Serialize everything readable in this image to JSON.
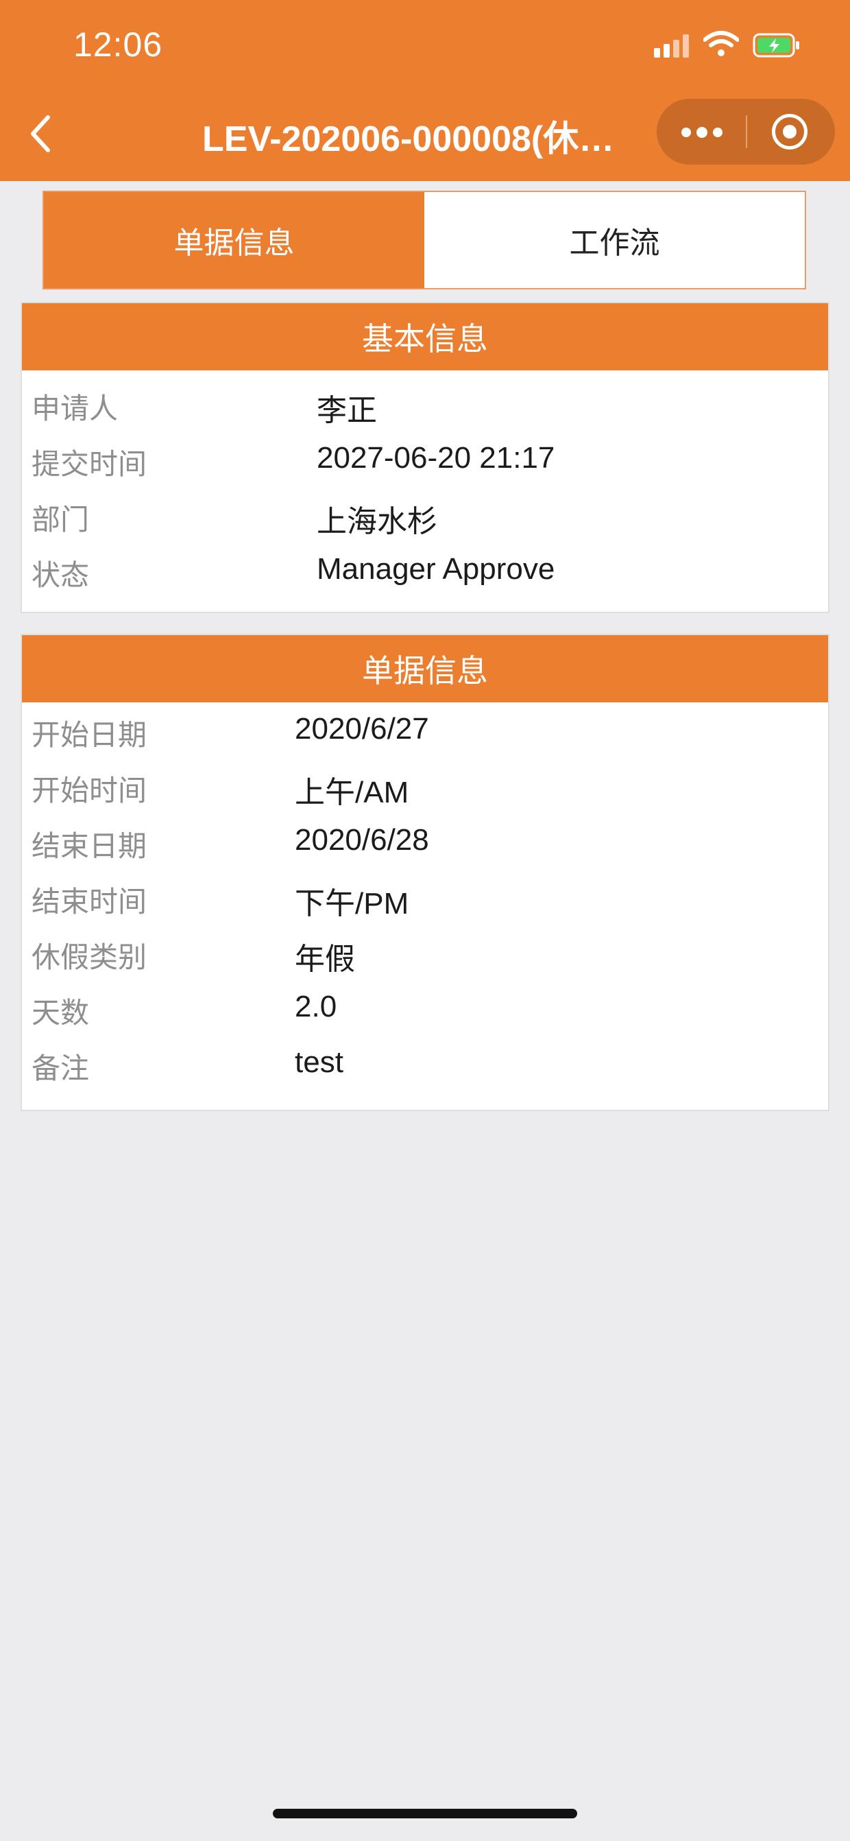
{
  "status_bar": {
    "time": "12:06"
  },
  "nav": {
    "title": "LEV-202006-000008(休…"
  },
  "tabs": [
    {
      "label": "单据信息",
      "active": true
    },
    {
      "label": "工作流",
      "active": false
    }
  ],
  "basic_info": {
    "title": "基本信息",
    "rows": [
      {
        "label": "申请人",
        "value": "李正"
      },
      {
        "label": "提交时间",
        "value": "2027-06-20 21:17"
      },
      {
        "label": "部门",
        "value": "上海水杉"
      },
      {
        "label": "状态",
        "value": "Manager Approve"
      }
    ]
  },
  "document_info": {
    "title": "单据信息",
    "rows": [
      {
        "label": "开始日期",
        "value": "2020/6/27"
      },
      {
        "label": "开始时间",
        "value": "上午/AM"
      },
      {
        "label": "结束日期",
        "value": "2020/6/28"
      },
      {
        "label": "结束时间",
        "value": "下午/PM"
      },
      {
        "label": "休假类别",
        "value": "年假"
      },
      {
        "label": "天数",
        "value": "2.0"
      },
      {
        "label": "备注",
        "value": "test"
      }
    ]
  },
  "colors": {
    "accent": "#ec7e2f",
    "background": "#ececee",
    "label_gray": "#8e8e8e"
  }
}
